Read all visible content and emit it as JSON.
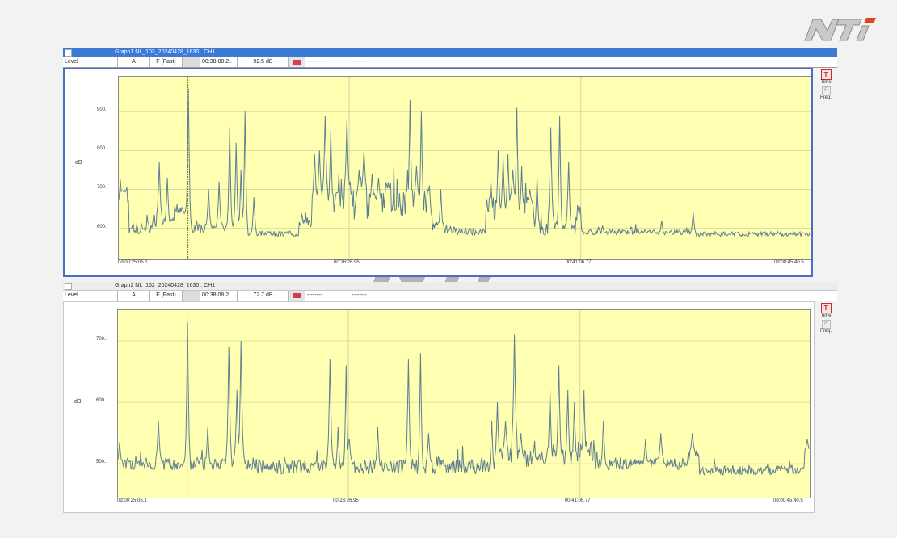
{
  "logo": {
    "text": "NTi"
  },
  "watermark": {
    "text": "NTi"
  },
  "colors": {
    "plot_bg": "#ffffb2",
    "trace": "#5e7f92",
    "cursor": "#6b7a2a"
  },
  "graphs": [
    {
      "title": "Graph1 NL_103_20240428_1630.. CH1",
      "toolbar": {
        "measure": "Level",
        "weighting": "A",
        "time_weighting": "F (Fast)",
        "time": "00:38:08.2..",
        "value": "92.5 dB",
        "field1": "--------",
        "field2": "--------"
      },
      "side": {
        "time_label": "Time",
        "freq_label": "Freq.",
        "time_icon": "T",
        "freq_icon": "F"
      },
      "y_unit": "dB",
      "y_ticks": [
        {
          "label": "900..",
          "v": 90
        },
        {
          "label": "800..",
          "v": 80
        },
        {
          "label": "700..",
          "v": 70
        },
        {
          "label": "600..",
          "v": 60
        }
      ],
      "x_ticks": [
        {
          "label": "0d:00:25:05.1",
          "t": 0
        },
        {
          "label": "00:26:26.95",
          "t": 0.333
        },
        {
          "label": "00:41:06.77",
          "t": 0.668
        },
        {
          "label": "0d:00:45:40.5",
          "t": 1
        }
      ],
      "chart_data": {
        "type": "line",
        "ylim": [
          52,
          99
        ],
        "baseline_segments": [
          [
            0,
            0.015,
            67,
            1.5
          ],
          [
            0.015,
            0.05,
            60,
            1.5
          ],
          [
            0.05,
            0.08,
            62,
            1.5
          ],
          [
            0.08,
            0.1,
            65,
            1.5
          ],
          [
            0.1,
            0.17,
            60,
            1.2
          ],
          [
            0.17,
            0.26,
            58.5,
            0.8
          ],
          [
            0.26,
            0.28,
            62,
            2
          ],
          [
            0.28,
            0.45,
            66,
            4
          ],
          [
            0.45,
            0.49,
            60,
            1.5
          ],
          [
            0.49,
            0.53,
            59,
            1
          ],
          [
            0.53,
            0.6,
            65,
            3
          ],
          [
            0.6,
            0.66,
            60,
            2
          ],
          [
            0.66,
            0.668,
            64,
            2
          ],
          [
            0.668,
            0.83,
            59,
            0.7
          ],
          [
            0.83,
            1.0,
            58.5,
            0.6
          ]
        ],
        "spikes": [
          [
            0.002,
            72.5
          ],
          [
            0.008,
            69
          ],
          [
            0.058,
            77
          ],
          [
            0.07,
            73
          ],
          [
            0.1,
            96
          ],
          [
            0.13,
            70
          ],
          [
            0.145,
            72
          ],
          [
            0.16,
            86
          ],
          [
            0.17,
            82
          ],
          [
            0.177,
            75
          ],
          [
            0.183,
            90
          ],
          [
            0.195,
            68
          ],
          [
            0.283,
            79
          ],
          [
            0.29,
            80
          ],
          [
            0.298,
            89
          ],
          [
            0.306,
            85
          ],
          [
            0.318,
            74
          ],
          [
            0.33,
            88
          ],
          [
            0.335,
            72
          ],
          [
            0.347,
            75
          ],
          [
            0.354,
            80
          ],
          [
            0.366,
            74
          ],
          [
            0.375,
            73
          ],
          [
            0.39,
            69
          ],
          [
            0.417,
            75
          ],
          [
            0.421,
            93
          ],
          [
            0.43,
            76
          ],
          [
            0.437,
            90
          ],
          [
            0.449,
            71
          ],
          [
            0.465,
            70
          ],
          [
            0.538,
            72
          ],
          [
            0.548,
            80
          ],
          [
            0.555,
            78
          ],
          [
            0.563,
            79
          ],
          [
            0.57,
            75
          ],
          [
            0.576,
            91
          ],
          [
            0.582,
            76
          ],
          [
            0.594,
            70
          ],
          [
            0.605,
            73
          ],
          [
            0.624,
            86
          ],
          [
            0.637,
            89
          ],
          [
            0.65,
            77
          ],
          [
            0.785,
            62
          ],
          [
            0.83,
            64
          ]
        ]
      }
    },
    {
      "title": "Graph2 NL_162_20240428_1630.. CH1",
      "toolbar": {
        "measure": "Level",
        "weighting": "A",
        "time_weighting": "F (Fast)",
        "time": "00:38:08.2..",
        "value": "72.7 dB",
        "field1": "--------",
        "field2": "--------"
      },
      "side": {
        "time_label": "Time",
        "freq_label": "Freq.",
        "time_icon": "T",
        "freq_icon": "F"
      },
      "y_unit": "dB",
      "y_ticks": [
        {
          "label": "700..",
          "v": 70
        },
        {
          "label": "600..",
          "v": 60
        },
        {
          "label": "500..",
          "v": 50
        }
      ],
      "x_ticks": [
        {
          "label": "0d:00:25:05.1",
          "t": 0
        },
        {
          "label": "00:26:26.95",
          "t": 0.333
        },
        {
          "label": "00:41:06.77",
          "t": 0.668
        },
        {
          "label": "0d:00:45:40.5",
          "t": 1
        }
      ],
      "chart_data": {
        "type": "line",
        "ylim": [
          44.5,
          75
        ],
        "baseline_segments": [
          [
            0,
            0.2,
            50,
            1
          ],
          [
            0.2,
            0.55,
            49.5,
            1.2
          ],
          [
            0.55,
            0.66,
            51,
            1.5
          ],
          [
            0.66,
            0.69,
            52,
            2
          ],
          [
            0.69,
            0.83,
            50,
            1
          ],
          [
            0.83,
            0.84,
            51,
            1.5
          ],
          [
            0.84,
            0.995,
            49,
            0.8
          ],
          [
            0.995,
            1.0,
            52,
            1
          ]
        ],
        "spikes": [
          [
            0.002,
            53.5
          ],
          [
            0.058,
            57
          ],
          [
            0.1,
            73
          ],
          [
            0.13,
            56
          ],
          [
            0.16,
            69
          ],
          [
            0.172,
            62
          ],
          [
            0.178,
            70
          ],
          [
            0.306,
            67
          ],
          [
            0.318,
            56
          ],
          [
            0.33,
            66
          ],
          [
            0.335,
            54
          ],
          [
            0.375,
            56
          ],
          [
            0.42,
            67
          ],
          [
            0.437,
            68
          ],
          [
            0.449,
            55
          ],
          [
            0.54,
            57
          ],
          [
            0.548,
            60
          ],
          [
            0.56,
            57
          ],
          [
            0.573,
            71
          ],
          [
            0.582,
            55
          ],
          [
            0.625,
            62
          ],
          [
            0.638,
            66
          ],
          [
            0.65,
            62
          ],
          [
            0.66,
            60
          ],
          [
            0.674,
            62
          ],
          [
            0.702,
            57
          ],
          [
            0.763,
            54
          ],
          [
            0.785,
            55
          ],
          [
            0.83,
            55
          ],
          [
            0.996,
            54
          ]
        ]
      }
    }
  ]
}
